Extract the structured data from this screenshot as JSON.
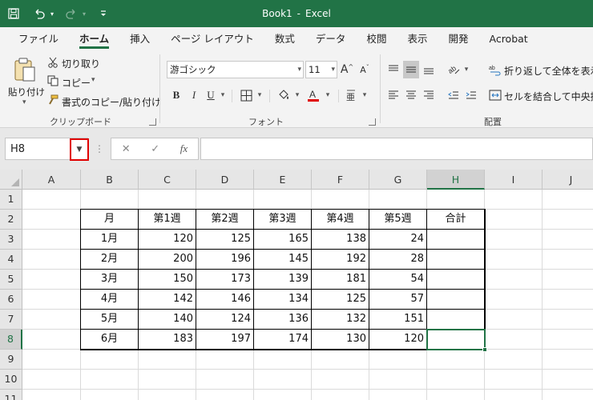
{
  "title_bar": {
    "app_title": "Book1",
    "separator": "-",
    "app_name": "Excel"
  },
  "ribbon_tabs": [
    "ファイル",
    "ホーム",
    "挿入",
    "ページ レイアウト",
    "数式",
    "データ",
    "校閲",
    "表示",
    "開発",
    "Acrobat"
  ],
  "active_tab": "ホーム",
  "clipboard": {
    "paste": "貼り付け",
    "cut": "切り取り",
    "copy": "コピー",
    "format_painter": "書式のコピー/貼り付け",
    "group_label": "クリップボード"
  },
  "font": {
    "font_name": "游ゴシック",
    "font_size": "11",
    "group_label": "フォント",
    "bold": "B",
    "italic": "I",
    "underline": "U"
  },
  "alignment": {
    "wrap_text": "折り返して全体を表示す",
    "merge_center": "セルを結合して中央揃え",
    "group_label": "配置"
  },
  "formula_bar": {
    "name_box": "H8",
    "fx": "fx",
    "formula": ""
  },
  "columns": [
    "A",
    "B",
    "C",
    "D",
    "E",
    "F",
    "G",
    "H",
    "I",
    "J"
  ],
  "selected_column": "H",
  "rows": [
    "1",
    "2",
    "3",
    "4",
    "5",
    "6",
    "7",
    "8",
    "9",
    "10",
    "11"
  ],
  "selected_row": "8",
  "table": {
    "headers": [
      "月",
      "第1週",
      "第2週",
      "第3週",
      "第4週",
      "第5週",
      "合計"
    ],
    "body": [
      [
        "1月",
        "120",
        "125",
        "165",
        "138",
        "24",
        ""
      ],
      [
        "2月",
        "200",
        "196",
        "145",
        "192",
        "28",
        ""
      ],
      [
        "3月",
        "150",
        "173",
        "139",
        "181",
        "54",
        ""
      ],
      [
        "4月",
        "142",
        "146",
        "134",
        "125",
        "57",
        ""
      ],
      [
        "5月",
        "140",
        "124",
        "136",
        "132",
        "151",
        ""
      ],
      [
        "6月",
        "183",
        "197",
        "174",
        "130",
        "120",
        ""
      ]
    ]
  },
  "accent_color": "#217346",
  "highlight_color": "#e00000"
}
